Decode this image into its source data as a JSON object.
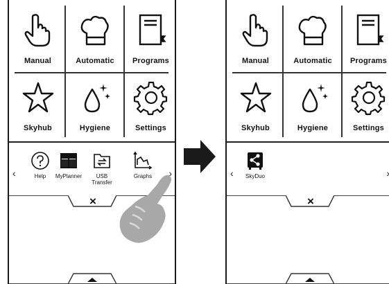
{
  "left_screen": {
    "tiles": [
      {
        "label": "Manual",
        "icon": "hand-icon"
      },
      {
        "label": "Automatic",
        "icon": "chef-hat-icon"
      },
      {
        "label": "Programs",
        "icon": "book-icon"
      },
      {
        "label": "Skyhub",
        "icon": "star-icon"
      },
      {
        "label": "Hygiene",
        "icon": "drop-icon"
      },
      {
        "label": "Settings",
        "icon": "gear-icon"
      }
    ],
    "shortcuts": [
      {
        "label": "Help",
        "icon": "help-icon"
      },
      {
        "label": "MyPlanner",
        "icon": "planner-icon"
      },
      {
        "label": "USB Transfer",
        "icon": "usb-transfer-icon"
      },
      {
        "label": "Graphs",
        "icon": "graphs-icon"
      }
    ],
    "nav_prev": "‹",
    "nav_next": "›",
    "close_label": "×"
  },
  "right_screen": {
    "tiles": [
      {
        "label": "Manual",
        "icon": "hand-icon"
      },
      {
        "label": "Automatic",
        "icon": "chef-hat-icon"
      },
      {
        "label": "Programs",
        "icon": "book-icon"
      },
      {
        "label": "Skyhub",
        "icon": "star-icon"
      },
      {
        "label": "Hygiene",
        "icon": "drop-icon"
      },
      {
        "label": "Settings",
        "icon": "gear-icon"
      }
    ],
    "shortcuts": [
      {
        "label": "SkyDuo",
        "icon": "skyduo-icon"
      }
    ],
    "nav_prev": "‹",
    "nav_next": "›",
    "close_label": "×"
  },
  "colors": {
    "line": "#1a1a1a",
    "hand": "#aaaaaa",
    "arrow": "#1a1a1a"
  }
}
